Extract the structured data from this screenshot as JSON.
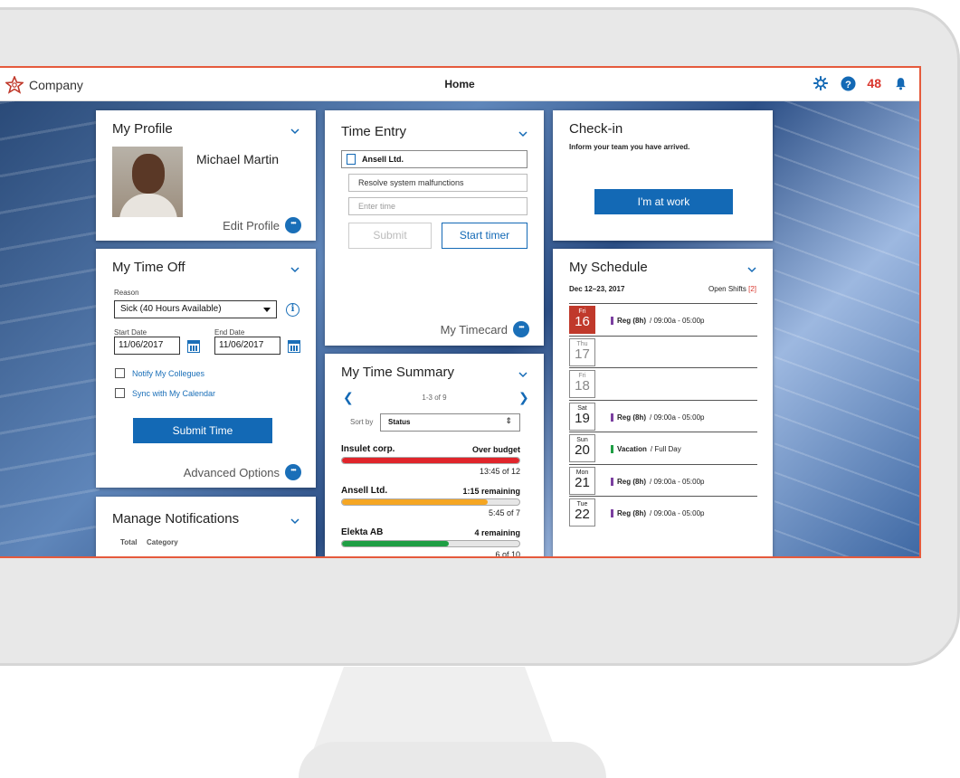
{
  "brand": {
    "name": "Company"
  },
  "header": {
    "title": "Home",
    "notification_count": "48"
  },
  "profile": {
    "title": "My Profile",
    "name": "Michael Martin",
    "edit_label": "Edit Profile"
  },
  "time_off": {
    "title": "My Time Off",
    "reason_label": "Reason",
    "reason_value": "Sick (40 Hours Available)",
    "start_label": "Start Date",
    "start_value": "11/06/2017",
    "end_label": "End Date",
    "end_value": "11/06/2017",
    "notify_label": "Notify My Collegues",
    "sync_label": "Sync with My Calendar",
    "submit_label": "Submit Time",
    "advanced_label": "Advanced Options"
  },
  "notifications": {
    "title": "Manage Notifications",
    "col_total": "Total",
    "col_category": "Category"
  },
  "time_entry": {
    "title": "Time Entry",
    "client": "Ansell Ltd.",
    "task": "Resolve system malfunctions",
    "time_placeholder": "Enter time",
    "submit_label": "Submit",
    "timer_label": "Start timer",
    "timecard_label": "My Timecard"
  },
  "time_summary": {
    "title": "My Time Summary",
    "pager": "1-3 of 9",
    "sort_label": "Sort by",
    "sort_value": "Status",
    "items": [
      {
        "name": "Insulet corp.",
        "status": "Over budget",
        "count": "13:45 of 12",
        "progress": 1.0,
        "color": "#e0252b"
      },
      {
        "name": "Ansell Ltd.",
        "status": "1:15 remaining",
        "count": "5:45 of 7",
        "progress": 0.82,
        "color": "#f5a623"
      },
      {
        "name": "Elekta AB",
        "status": "4 remaining",
        "count": "6 of 10",
        "progress": 0.6,
        "color": "#1f9e44"
      }
    ]
  },
  "checkin": {
    "title": "Check-in",
    "subtitle": "Inform your team you have arrived.",
    "button_label": "I'm at work"
  },
  "schedule": {
    "title": "My Schedule",
    "range": "Dec 12–23, 2017",
    "open_shifts_label": "Open Shifts",
    "open_shifts_count": "[2]",
    "days": [
      {
        "dow": "Fri",
        "day": "16",
        "shift_type": "Reg (8h)",
        "shift_time": "/ 09:00a - 05:00p",
        "today": true,
        "mark_color": "#7b3fa0"
      },
      {
        "dow": "Thu",
        "day": "17",
        "shift_type": "",
        "shift_time": ""
      },
      {
        "dow": "Fri",
        "day": "18",
        "shift_type": "",
        "shift_time": ""
      },
      {
        "dow": "Sat",
        "day": "19",
        "shift_type": "Reg (8h)",
        "shift_time": "/ 09:00a - 05:00p",
        "mark_color": "#7b3fa0"
      },
      {
        "dow": "Sun",
        "day": "20",
        "shift_type": "Vacation",
        "shift_time": "/ Full Day",
        "mark_color": "#1f9e44"
      },
      {
        "dow": "Mon",
        "day": "21",
        "shift_type": "Reg (8h)",
        "shift_time": "/ 09:00a - 05:00p",
        "mark_color": "#7b3fa0"
      },
      {
        "dow": "Tue",
        "day": "22",
        "shift_type": "Reg (8h)",
        "shift_time": "/ 09:00a - 05:00p",
        "mark_color": "#7b3fa0"
      }
    ]
  },
  "colors": {
    "accent": "#1369b5",
    "frame": "#e55a3c",
    "today": "#c0392b",
    "alert": "#d9352c"
  }
}
